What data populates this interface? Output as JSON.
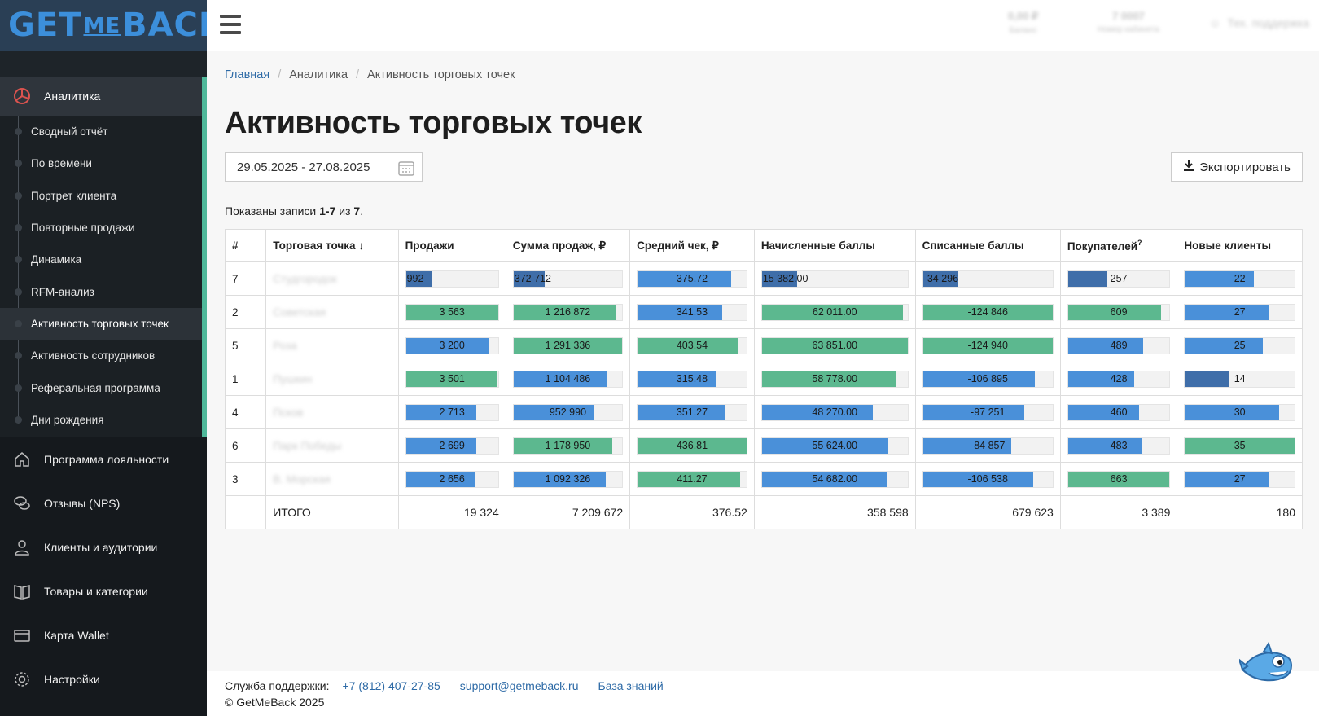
{
  "logo": {
    "get": "GET",
    "me": "ME",
    "back": "BACK"
  },
  "sidebar": {
    "parent": {
      "label": "Аналитика",
      "icon": "analytics-icon"
    },
    "subitems": [
      {
        "label": "Сводный отчёт"
      },
      {
        "label": "По времени"
      },
      {
        "label": "Портрет клиента"
      },
      {
        "label": "Повторные продажи"
      },
      {
        "label": "Динамика"
      },
      {
        "label": "RFM-анализ"
      },
      {
        "label": "Активность торговых точек",
        "active": true
      },
      {
        "label": "Активность сотрудников"
      },
      {
        "label": "Реферальная программа"
      },
      {
        "label": "Дни рождения"
      }
    ],
    "items": [
      {
        "label": "Программа лояльности",
        "icon": "home-icon"
      },
      {
        "label": "Отзывы (NPS)",
        "icon": "chat-icon"
      },
      {
        "label": "Клиенты и аудитории",
        "icon": "user-icon"
      },
      {
        "label": "Товары и категории",
        "icon": "book-icon"
      },
      {
        "label": "Карта Wallet",
        "icon": "wallet-icon"
      },
      {
        "label": "Настройки",
        "icon": "gear-icon"
      }
    ]
  },
  "topbar": {
    "stat1": {
      "value": "0,00 ₽",
      "label": "Баланс"
    },
    "stat2": {
      "value": "7 0007",
      "label": "Номер кабинета"
    },
    "user": "Тех. поддержка"
  },
  "breadcrumb": {
    "home": "Главная",
    "section": "Аналитика",
    "current": "Активность торговых точек"
  },
  "title": "Активность торговых точек",
  "date_range": "29.05.2025 - 27.08.2025",
  "export_label": "Экспортировать",
  "summary": {
    "prefix": "Показаны записи ",
    "range": "1-7",
    "of": " из ",
    "total": "7",
    "suffix": "."
  },
  "table": {
    "headers": [
      "#",
      "Торговая точка",
      "Продажи",
      "Сумма продаж, ₽",
      "Средний чек, ₽",
      "Начисленные баллы",
      "Списанные баллы",
      "Покупателей",
      "Новые клиенты"
    ],
    "sort_indicator": "↓",
    "buyers_hint": "?",
    "rows": [
      {
        "num": "7",
        "store": "Студгородок",
        "cells": [
          {
            "label": "992",
            "fill": 0.28,
            "color": "dark",
            "align": "left"
          },
          {
            "label": "372 712",
            "fill": 0.29,
            "color": "dark",
            "align": "left"
          },
          {
            "label": "375.72",
            "fill": 0.86,
            "color": "blue"
          },
          {
            "label": "15 382.00",
            "fill": 0.24,
            "color": "dark",
            "align": "left"
          },
          {
            "label": "-34 296",
            "fill": 0.27,
            "color": "dark",
            "align": "left"
          },
          {
            "label": "257",
            "fill": 0.39,
            "color": "dark"
          },
          {
            "label": "22",
            "fill": 0.63,
            "color": "blue"
          }
        ]
      },
      {
        "num": "2",
        "store": "Советская",
        "cells": [
          {
            "label": "3 563",
            "fill": 1.0,
            "color": "green"
          },
          {
            "label": "1 216 872",
            "fill": 0.94,
            "color": "green"
          },
          {
            "label": "341.53",
            "fill": 0.78,
            "color": "blue"
          },
          {
            "label": "62 011.00",
            "fill": 0.97,
            "color": "green"
          },
          {
            "label": "-124 846",
            "fill": 1.0,
            "color": "green"
          },
          {
            "label": "609",
            "fill": 0.92,
            "color": "green"
          },
          {
            "label": "27",
            "fill": 0.77,
            "color": "blue"
          }
        ]
      },
      {
        "num": "5",
        "store": "Роза",
        "cells": [
          {
            "label": "3 200",
            "fill": 0.9,
            "color": "blue"
          },
          {
            "label": "1 291 336",
            "fill": 1.0,
            "color": "green"
          },
          {
            "label": "403.54",
            "fill": 0.92,
            "color": "green"
          },
          {
            "label": "63 851.00",
            "fill": 1.0,
            "color": "green"
          },
          {
            "label": "-124 940",
            "fill": 1.0,
            "color": "green"
          },
          {
            "label": "489",
            "fill": 0.74,
            "color": "blue"
          },
          {
            "label": "25",
            "fill": 0.71,
            "color": "blue"
          }
        ]
      },
      {
        "num": "1",
        "store": "Пушкин",
        "cells": [
          {
            "label": "3 501",
            "fill": 0.98,
            "color": "green"
          },
          {
            "label": "1 104 486",
            "fill": 0.86,
            "color": "blue"
          },
          {
            "label": "315.48",
            "fill": 0.72,
            "color": "blue"
          },
          {
            "label": "58 778.00",
            "fill": 0.92,
            "color": "green"
          },
          {
            "label": "-106 895",
            "fill": 0.86,
            "color": "blue"
          },
          {
            "label": "428",
            "fill": 0.65,
            "color": "blue"
          },
          {
            "label": "14",
            "fill": 0.4,
            "color": "dark"
          }
        ]
      },
      {
        "num": "4",
        "store": "Псков",
        "cells": [
          {
            "label": "2 713",
            "fill": 0.76,
            "color": "blue"
          },
          {
            "label": "952 990",
            "fill": 0.74,
            "color": "blue"
          },
          {
            "label": "351.27",
            "fill": 0.8,
            "color": "blue"
          },
          {
            "label": "48 270.00",
            "fill": 0.76,
            "color": "blue"
          },
          {
            "label": "-97 251",
            "fill": 0.78,
            "color": "blue"
          },
          {
            "label": "460",
            "fill": 0.7,
            "color": "blue"
          },
          {
            "label": "30",
            "fill": 0.86,
            "color": "blue"
          }
        ]
      },
      {
        "num": "6",
        "store": "Парк Победы",
        "cells": [
          {
            "label": "2 699",
            "fill": 0.76,
            "color": "blue"
          },
          {
            "label": "1 178 950",
            "fill": 0.91,
            "color": "green"
          },
          {
            "label": "436.81",
            "fill": 1.0,
            "color": "green"
          },
          {
            "label": "55 624.00",
            "fill": 0.87,
            "color": "blue"
          },
          {
            "label": "-84 857",
            "fill": 0.68,
            "color": "blue"
          },
          {
            "label": "483",
            "fill": 0.73,
            "color": "blue"
          },
          {
            "label": "35",
            "fill": 1.0,
            "color": "green"
          }
        ]
      },
      {
        "num": "3",
        "store": "В. Морская",
        "cells": [
          {
            "label": "2 656",
            "fill": 0.75,
            "color": "blue"
          },
          {
            "label": "1 092 326",
            "fill": 0.85,
            "color": "blue"
          },
          {
            "label": "411.27",
            "fill": 0.94,
            "color": "green"
          },
          {
            "label": "54 682.00",
            "fill": 0.86,
            "color": "blue"
          },
          {
            "label": "-106 538",
            "fill": 0.85,
            "color": "blue"
          },
          {
            "label": "663",
            "fill": 1.0,
            "color": "green"
          },
          {
            "label": "27",
            "fill": 0.77,
            "color": "blue"
          }
        ]
      }
    ],
    "total": {
      "label": "ИТОГО",
      "values": [
        "19 324",
        "7 209 672",
        "376.52",
        "358 598",
        "679 623",
        "3 389",
        "180"
      ]
    }
  },
  "footer": {
    "support_label": "Служба поддержки:",
    "phone": "+7 (812) 407-27-85",
    "email": "support@getmeback.ru",
    "kb": "База знаний",
    "copyright": "© GetMeBack 2025"
  },
  "colors": {
    "blue": "#4a90d9",
    "green": "#5cb88f",
    "dark": "#3f6ea9",
    "accent": "#4fb89a"
  }
}
